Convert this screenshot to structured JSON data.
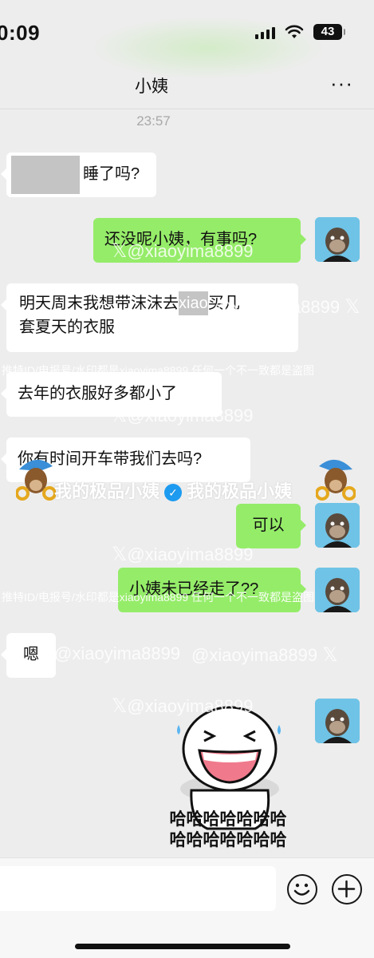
{
  "status_bar": {
    "time": "0:09",
    "battery": "43",
    "icons": [
      "signal-icon",
      "wifi-icon",
      "battery-icon"
    ]
  },
  "nav": {
    "title": "小姨",
    "more": "···"
  },
  "chat": {
    "timestamp": "23:57",
    "messages": [
      {
        "side": "in",
        "text": "睡了吗?"
      },
      {
        "side": "out",
        "text": "还没呢小姨，有事吗?"
      },
      {
        "side": "in",
        "line1_a": "明天周末我想带沫沫去",
        "line1_censored": "xiao",
        "line1_b": "买几",
        "line2": "套夏天的衣服"
      },
      {
        "side": "in",
        "text": "去年的衣服好多都小了"
      },
      {
        "side": "in",
        "text": "你有时间开车带我们去吗?"
      },
      {
        "side": "out",
        "text": "可以"
      },
      {
        "side": "out",
        "text": "小姨未已经走了??"
      },
      {
        "side": "in",
        "text": "嗯"
      }
    ],
    "sticker": {
      "line1": "哈哈哈哈哈哈哈",
      "line2": "哈哈哈哈哈哈哈"
    }
  },
  "watermarks": {
    "handle": "@xiaoyima8899",
    "x_glyph": "𝕏",
    "notice": "推特ID/电报号/水印都是xiaoyima8899 任何一个不一致都是盗图",
    "brand": "我的极品小姨"
  },
  "colors": {
    "background": "#ededed",
    "outgoing_bubble": "#95ec69",
    "incoming_bubble": "#ffffff",
    "verified": "#1d9bf0"
  }
}
